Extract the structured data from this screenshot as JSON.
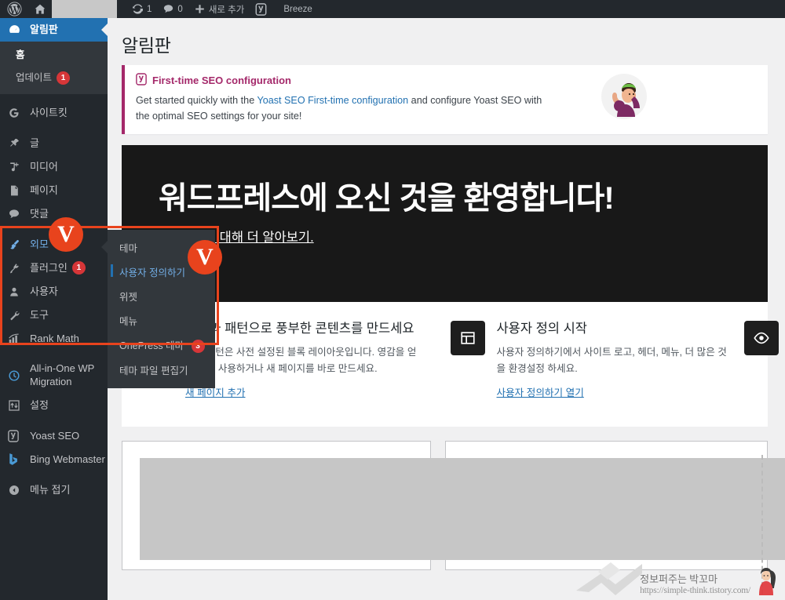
{
  "adminbar": {
    "logo_icon": "wordpress-logo-icon",
    "home_icon": "home-icon",
    "site_name_redacted": "",
    "updates_icon": "updates-icon",
    "updates_count": "1",
    "comments_icon": "comment-bubble-icon",
    "comments_count": "0",
    "new_icon": "plus-icon",
    "new_label": "새로 추가",
    "yoast_icon": "yoast-seo-icon",
    "breeze_label": "Breeze"
  },
  "sidebar": {
    "items": [
      {
        "label": "알림판",
        "icon": "dashboard-icon",
        "active": true
      },
      {
        "label": "홈",
        "icon": "",
        "sub": true,
        "bold": true
      },
      {
        "label": "업데이트",
        "icon": "",
        "sub": true,
        "badge": "1"
      },
      {
        "label": "사이트킷",
        "icon": "google-sitekit-icon"
      },
      {
        "label": "글",
        "icon": "pin-icon"
      },
      {
        "label": "미디어",
        "icon": "media-icon"
      },
      {
        "label": "페이지",
        "icon": "pages-icon"
      },
      {
        "label": "댓글",
        "icon": "comment-bubble-icon"
      },
      {
        "label": "외모",
        "icon": "appearance-brush-icon"
      },
      {
        "label": "플러그인",
        "icon": "plugin-icon",
        "badge": "1"
      },
      {
        "label": "사용자",
        "icon": "users-icon"
      },
      {
        "label": "도구",
        "icon": "tools-wrench-icon"
      },
      {
        "label": "Rank Math",
        "icon": "rankmath-icon"
      },
      {
        "label": "All-in-One WP Migration",
        "icon": "migration-icon"
      },
      {
        "label": "설정",
        "icon": "settings-sliders-icon"
      },
      {
        "label": "Yoast SEO",
        "icon": "yoast-seo-icon"
      },
      {
        "label": "Bing Webmaster",
        "icon": "bing-icon"
      },
      {
        "label": "메뉴 접기",
        "icon": "collapse-arrow-icon"
      }
    ]
  },
  "flyout": {
    "items": [
      {
        "label": "테마"
      },
      {
        "label": "사용자 정의하기",
        "current": true
      },
      {
        "label": "위젯"
      },
      {
        "label": "메뉴"
      },
      {
        "label": "OnePress 테마",
        "badge": "3"
      },
      {
        "label": "테마 파일 편집기"
      }
    ]
  },
  "page": {
    "title": "알림판"
  },
  "notice": {
    "icon": "yoast-seo-icon",
    "heading": "First-time SEO configuration",
    "body_before": "Get started quickly with the ",
    "link": "Yoast SEO First-time configuration",
    "body_after": " and configure Yoast SEO with the optimal SEO settings for your site!",
    "illustration": "woman-flexing-illustration",
    "accent_color": "#a4286a"
  },
  "welcome": {
    "heading": "워드프레스에 오신 것을 환영합니다!",
    "version_link": "6.3 버전에 대해 더 알아보기.",
    "columns": [
      {
        "icon": "blocks-grid-icon",
        "title": "블록과 패턴으로 풍부한 콘텐츠를 만드세요",
        "desc": "블록 패턴은 사전 설정된 블록 레이아웃입니다. 영감을 얻기 위해 사용하거나 새 페이지를 바로 만드세요.",
        "link": "새 페이지 추가"
      },
      {
        "icon": "customize-layout-icon",
        "title": "사용자 정의 시작",
        "desc": "사용자 정의하기에서 사이트 로고, 헤더, 메뉴, 더 많은 것을 환경설정 하세요.",
        "link": "사용자 정의하기 열기"
      },
      {
        "icon": "eye-icon",
        "title": "",
        "desc": "",
        "link": ""
      }
    ]
  },
  "annotations": {
    "accent_color": "#e8431d",
    "check_glyph": "V",
    "rect_label": "appearance-group-highlight",
    "circle_labels": [
      "appearance-menu-check",
      "customize-submenu-check"
    ]
  },
  "watermark": {
    "name": "정보퍼주는 박꼬마",
    "url": "https://simple-think.tistory.com/",
    "avatar": "woman-avatar-icon"
  }
}
